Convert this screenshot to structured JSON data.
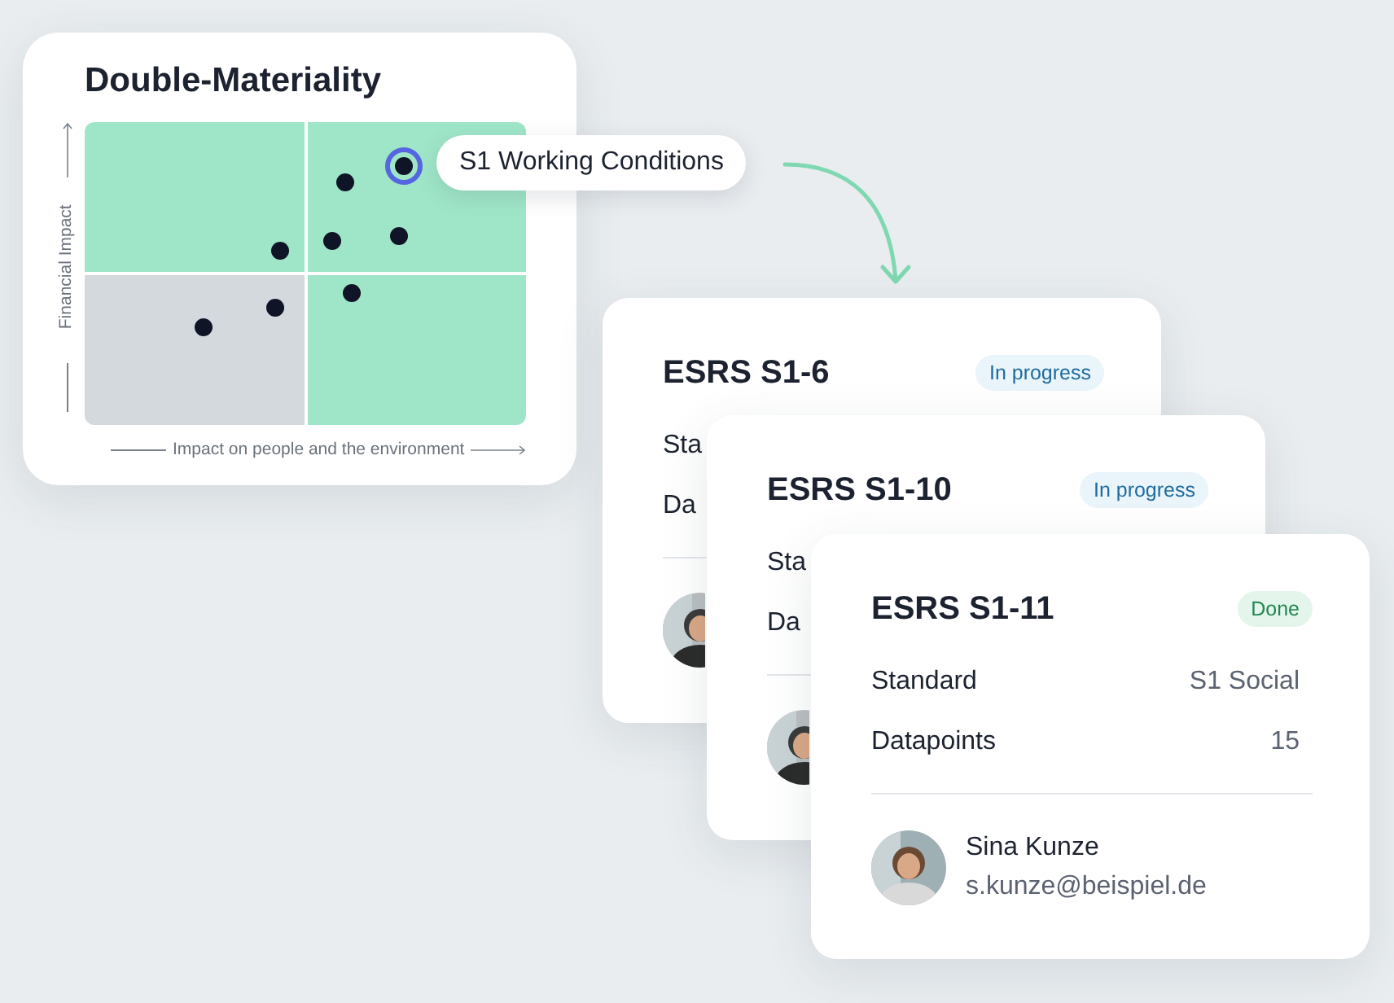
{
  "matrix": {
    "title": "Double-Materiality",
    "y_axis_label": "Financial Impact",
    "x_axis_label": "Impact on people and the environment",
    "callout": "S1 Working Conditions"
  },
  "cards": [
    {
      "title": "ESRS S1-6",
      "status": {
        "label": "In progress",
        "kind": "in_progress"
      },
      "rows": [
        {
          "label": "Sta"
        },
        {
          "label": "Da"
        }
      ]
    },
    {
      "title": "ESRS S1-10",
      "status": {
        "label": "In progress",
        "kind": "in_progress"
      },
      "rows": [
        {
          "label": "Sta"
        },
        {
          "label": "Da"
        }
      ]
    },
    {
      "title": "ESRS S1-11",
      "status": {
        "label": "Done",
        "kind": "done"
      },
      "rows": [
        {
          "label": "Standard",
          "value": "S1 Social"
        },
        {
          "label": "Datapoints",
          "value": "15"
        }
      ],
      "person": {
        "name": "Sina Kunze",
        "email": "s.kunze@beispiel.de"
      }
    }
  ]
}
